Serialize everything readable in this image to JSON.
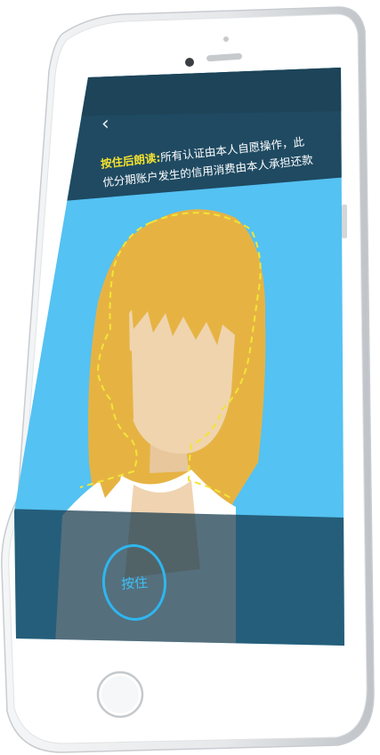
{
  "nav": {
    "back_icon": "‹"
  },
  "instruction": {
    "highlight": "按住后朗读:",
    "line1_rest": "所有认证由本人自愿操作，此",
    "line2": "优分期账户发生的信用消费由本人承担还款"
  },
  "record": {
    "button_label": "按住"
  },
  "colors": {
    "header_bg": "#1f4a62",
    "sky": "#54c2f2",
    "hair": "#e6b343",
    "face": "#efd4ad",
    "guide_line": "#f2e536",
    "accent": "#2fb6ee"
  },
  "icons": [
    "chevron-left-icon",
    "face-guide-outline",
    "home-button-icon"
  ]
}
